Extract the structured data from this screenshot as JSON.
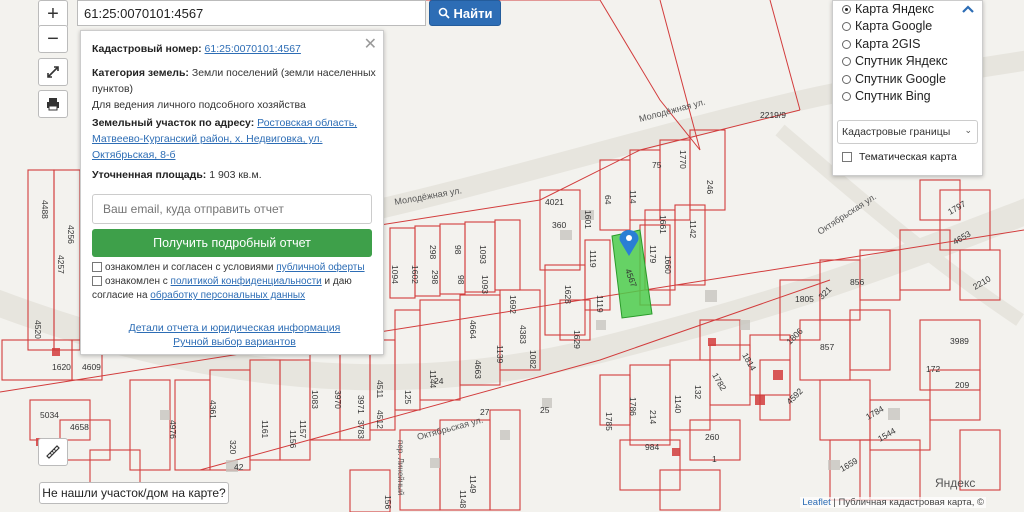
{
  "search": {
    "value": "61:25:0070101:4567",
    "button_label": "Найти"
  },
  "zoom": {
    "in": "+",
    "out": "−"
  },
  "info": {
    "cad_label": "Кадастровый номер:",
    "cad_value": "61:25:0070101:4567",
    "cat_label": "Категория земель:",
    "cat_value": "Земли поселений (земли населенных пунктов)",
    "use_value": "Для ведения личного подсобного хозяйства",
    "addr_label": "Земельный участок по адресу:",
    "addr_value": "Ростовская область, Матвеево-Курганский район, х. Недвиговка, ул. Октябрьская, 8-б",
    "area_label": "Уточненная площадь:",
    "area_value": "1 903 кв.м.",
    "email_placeholder": "Ваш email, куда отправить отчет",
    "report_button": "Получить подробный отчет",
    "check1_a": "ознакомлен и согласен с условиями ",
    "check1_link": "публичной оферты",
    "check2_a": "ознакомлен с ",
    "check2_link": "политикой конфиденциальности",
    "check2_b": " и даю согласие на ",
    "check2_link2": "обработку персональных данных",
    "details_link": "Детали отчета и юридическая информация",
    "manual_link": "Ручной выбор вариантов"
  },
  "layers": {
    "options": [
      "Карта Яндекс",
      "Карта Google",
      "Карта 2GIS",
      "Спутник Яндекс",
      "Спутник Google",
      "Спутник Bing"
    ],
    "selected": "Карта Яндекс",
    "select_value": "Кадастровые границы",
    "thematic": "Тематическая карта"
  },
  "not_found_button": "Не нашли участок/дом на карте?",
  "attribution": {
    "leaflet": "Leaflet",
    "sep": " | ",
    "pkk": "Публичная кадастровая карта",
    "suffix": ", ©",
    "yandex": "Яндекс"
  },
  "map": {
    "streets": [
      "Молодёжная ул.",
      "Молодёжная ул.",
      "Октябрьская ул.",
      "Октябрьская ул.",
      "пер. Линейный"
    ],
    "parcel_numbers": [
      "2219/9",
      "4021",
      "360",
      "1601",
      "64",
      "114",
      "75",
      "1770",
      "246",
      "1661",
      "1142",
      "1119",
      "1179",
      "1660",
      "4567",
      "1628",
      "1119",
      "1629",
      "4257",
      "4256",
      "4488",
      "4520",
      "1620",
      "4609",
      "1094",
      "1602",
      "298",
      "298",
      "98",
      "98",
      "1093",
      "1093",
      "1692",
      "4664",
      "4383",
      "1139",
      "4663",
      "1082",
      "125",
      "1144",
      "1805",
      "321",
      "856",
      "1806",
      "857",
      "1814",
      "1782",
      "132",
      "1140",
      "1786",
      "214",
      "1785",
      "984",
      "260",
      "4592",
      "1797",
      "4653",
      "2210",
      "3989",
      "172",
      "209",
      "1544",
      "1659",
      "1784",
      "5034",
      "4658",
      "4976",
      "4361",
      "320",
      "1161",
      "1156",
      "1157",
      "1083",
      "3970",
      "3783",
      "3971",
      "4511",
      "4512",
      "1148",
      "156",
      "1149",
      "42",
      "24",
      "25",
      "27",
      "1"
    ],
    "colors": {
      "parcel": "#d23c3c",
      "target_fill": "#4ccd4c",
      "marker": "#2a7fd4"
    }
  }
}
